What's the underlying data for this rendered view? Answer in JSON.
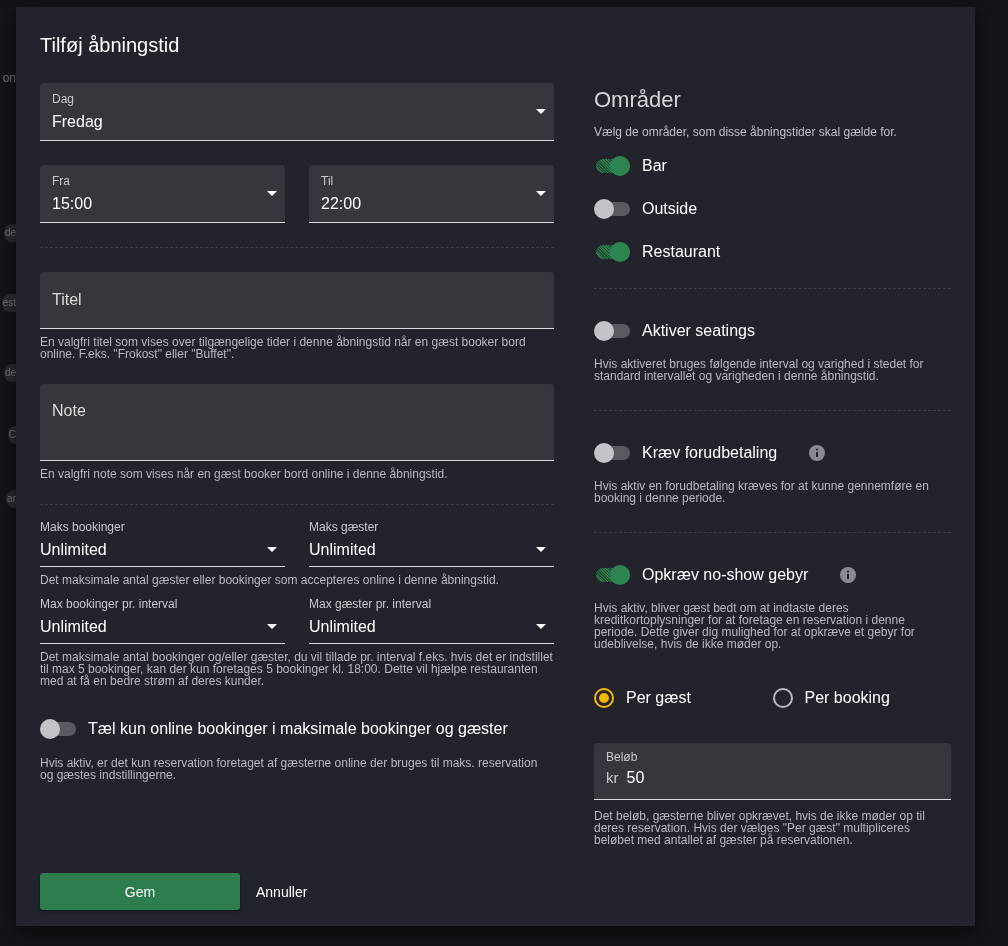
{
  "background_fragments": [
    {
      "text": "on",
      "kind": "plain"
    },
    {
      "text": "de",
      "kind": "chip"
    },
    {
      "text": "est",
      "kind": "chip"
    },
    {
      "text": "de",
      "kind": "chip"
    },
    {
      "text": "C",
      "kind": "chip"
    },
    {
      "text": "ar",
      "kind": "chip"
    }
  ],
  "dialog": {
    "title": "Tilføj åbningstid",
    "left": {
      "day": {
        "label": "Dag",
        "value": "Fredag"
      },
      "from": {
        "label": "Fra",
        "value": "15:00"
      },
      "to": {
        "label": "Til",
        "value": "22:00"
      },
      "title_field": {
        "placeholder": "Titel",
        "hint": "En valgfri titel som vises over tilgængelige tider i denne åbningstid når en gæst booker bord online. F.eks. \"Frokost\" eller \"Buffet\"."
      },
      "note_field": {
        "placeholder": "Note",
        "hint": "En valgfri note som vises når en gæst booker bord online i denne åbningstid."
      },
      "limits": [
        {
          "label": "Maks bookinger",
          "value": "Unlimited"
        },
        {
          "label": "Maks gæster",
          "value": "Unlimited"
        }
      ],
      "limits_hint": "Det maksimale antal gæster eller bookinger som accepteres online i denne åbningstid.",
      "interval_limits": [
        {
          "label": "Max bookinger pr. interval",
          "value": "Unlimited"
        },
        {
          "label": "Max gæster pr. interval",
          "value": "Unlimited"
        }
      ],
      "interval_hint": "Det maksimale antal bookinger og/eller gæster, du vil tillade pr. interval f.eks. hvis det er indstillet til max 5 bookinger, kan der kun foretages 5 bookinger kl. 18:00. Dette vil hjælpe restauranten med at få en bedre strøm af deres kunder.",
      "online_only": {
        "label": "Tæl kun online bookinger i maksimale bookinger og gæster",
        "on": false,
        "hint": "Hvis aktiv, er det kun reservation foretaget af gæsterne online der bruges til maks. reservation og gæstes indstillingerne."
      }
    },
    "right": {
      "areas": {
        "heading": "Områder",
        "description": "Vælg de områder, som disse åbningstider skal gælde for.",
        "items": [
          {
            "label": "Bar",
            "on": true
          },
          {
            "label": "Outside",
            "on": false
          },
          {
            "label": "Restaurant",
            "on": true
          }
        ]
      },
      "settings": [
        {
          "label": "Aktiver seatings",
          "on": false,
          "has_info": false,
          "hint": "Hvis aktiveret bruges følgende interval og varighed i stedet for standard intervallet og varigheden i denne åbningstid."
        },
        {
          "label": "Kræv forudbetaling",
          "on": false,
          "has_info": true,
          "hint": "Hvis aktiv en forudbetaling kræves for at kunne gennemføre en booking i denne periode."
        },
        {
          "label": "Opkræv no-show gebyr",
          "on": true,
          "has_info": true,
          "hint": "Hvis aktiv, bliver gæst bedt om at indtaste deres kreditkortoplysninger for at foretage en reservation i denne periode. Dette giver dig mulighed for at opkræve et gebyr for udeblivelse, hvis de ikke møder op."
        }
      ],
      "charge_mode": [
        {
          "label": "Per gæst",
          "selected": true
        },
        {
          "label": "Per booking",
          "selected": false
        }
      ],
      "amount": {
        "label": "Beløb",
        "prefix": "kr",
        "value": "50",
        "hint": "Det beløb, gæsterne bliver opkrævet, hvis de ikke møder op til deres reservation. Hvis der vælges \"Per gæst\" multipliceres beløbet med antallet af gæster på reservationen."
      }
    },
    "buttons": [
      {
        "label": "Gem",
        "kind": "primary"
      },
      {
        "label": "Annuller",
        "kind": "text"
      }
    ]
  }
}
